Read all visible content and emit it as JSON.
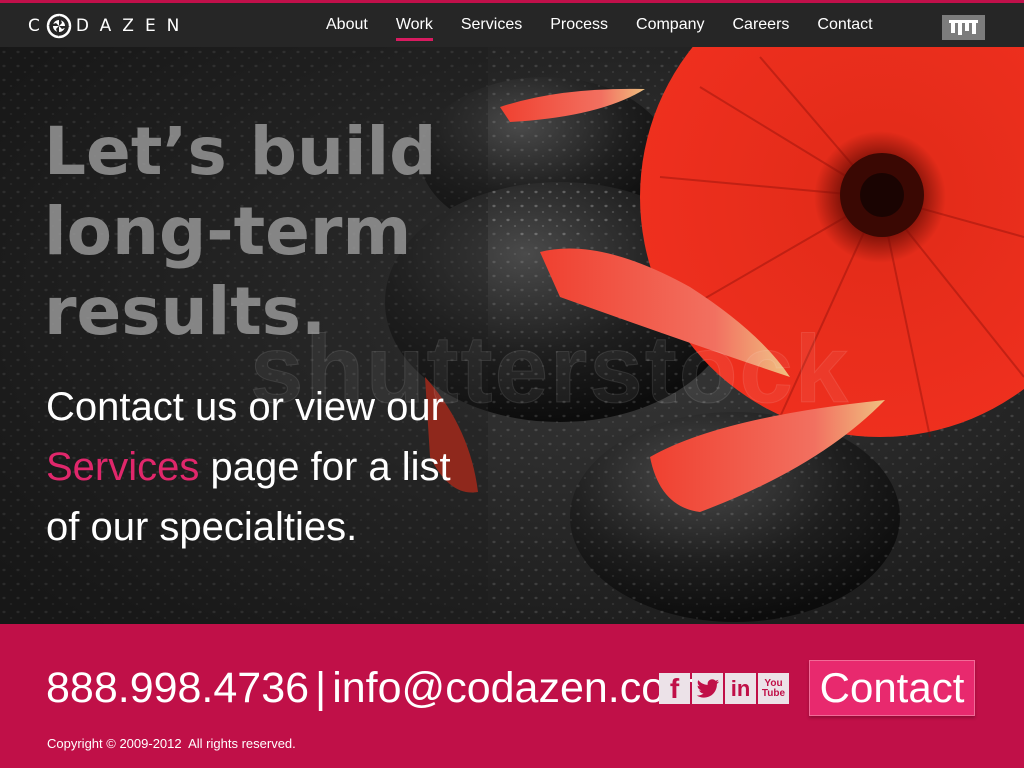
{
  "brand": {
    "first_letter": "C",
    "rest": "DAZEN",
    "accent_color": "#c0104a",
    "logo_icon": "compass-icon"
  },
  "nav": {
    "items": [
      {
        "label": "About",
        "active": false
      },
      {
        "label": "Work",
        "active": true
      },
      {
        "label": "Services",
        "active": false
      },
      {
        "label": "Process",
        "active": false
      },
      {
        "label": "Company",
        "active": false
      },
      {
        "label": "Careers",
        "active": false
      },
      {
        "label": "Contact",
        "active": false
      }
    ],
    "menu_icon": "menu-icon"
  },
  "hero": {
    "headline": [
      "Let’s build",
      "long-term",
      "results."
    ],
    "tagline_before": "Contact us or view our ",
    "tagline_link": "Services",
    "tagline_after": " page for a list of our specialties.",
    "watermark": "shutterstock",
    "link_color": "#e0276b"
  },
  "footer": {
    "phone": "888.998.4736",
    "separator": "|",
    "email": "info@codazen.com",
    "contact_button": "Contact",
    "copyright": "Copyright © 2009-2012  All rights reserved.",
    "background_color": "#c01048",
    "socials": [
      {
        "name": "facebook-icon",
        "glyph": "f"
      },
      {
        "name": "twitter-icon",
        "glyph": "t"
      },
      {
        "name": "linkedin-icon",
        "glyph": "in"
      },
      {
        "name": "youtube-icon",
        "glyph": "You Tube"
      }
    ]
  }
}
